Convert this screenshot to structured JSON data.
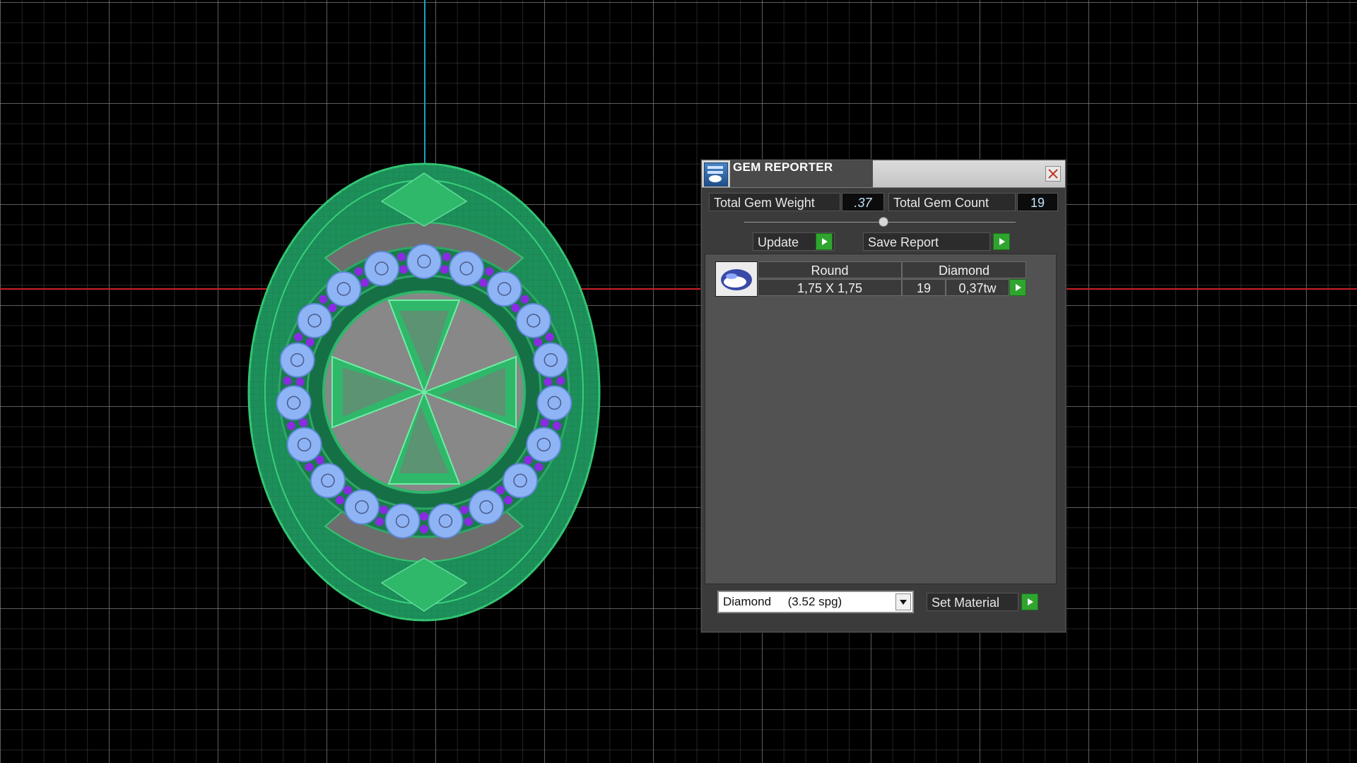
{
  "panel": {
    "title": "GEM REPORTER",
    "total_gem_weight_label": "Total Gem Weight",
    "total_gem_weight_value": ".37",
    "total_gem_count_label": "Total Gem Count",
    "total_gem_count_value": "19",
    "update_label": "Update",
    "save_report_label": "Save Report",
    "gem_rows": [
      {
        "shape": "Round",
        "size": "1,75 X 1,75",
        "material": "Diamond",
        "count": "19",
        "weight": "0,37tw"
      }
    ],
    "material_select_value": "Diamond     (3.52 spg)",
    "set_material_label": "Set Material"
  },
  "icons": {
    "title_icon": "gem-reporter-icon",
    "close": "close-icon",
    "go": "green-arrow-icon",
    "thumbnail": "round-gem-icon",
    "dropdown": "chevron-down-icon"
  },
  "colors": {
    "viewport_background": "#000000",
    "grid_major": "#8c8c8c",
    "x_axis": "#c8202a",
    "y_axis": "#1aa3b8",
    "ring_metal": "#2fbf6a",
    "gem_blue": "#8fb4f5",
    "prong_purple": "#8a2be2",
    "panel_bg": "#3b3b3b",
    "go_button": "#2fa52f"
  }
}
